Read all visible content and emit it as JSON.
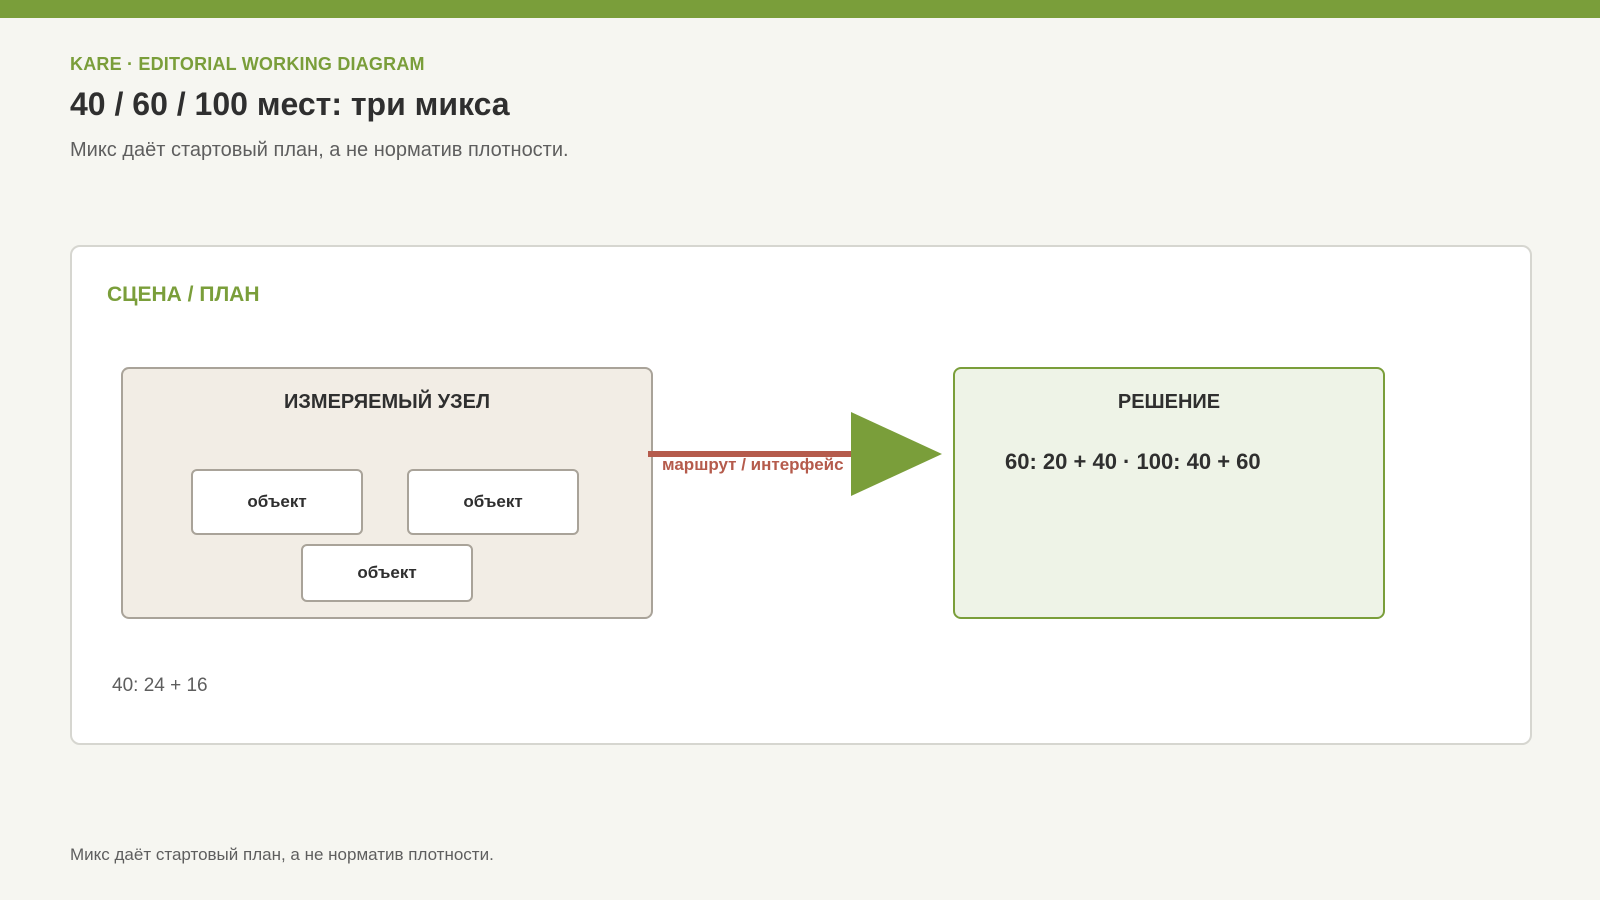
{
  "header": {
    "kicker": "KARE · EDITORIAL WORKING DIAGRAM",
    "title": "40 / 60 / 100 мест: три микса",
    "subtitle": "Микс даёт стартовый план, а не норматив плотности."
  },
  "panel": {
    "label": "СЦЕНА / ПЛАН",
    "node": {
      "title": "ИЗМЕРЯЕМЫЙ УЗЕЛ",
      "objects": [
        "объект",
        "объект",
        "объект"
      ]
    },
    "connector": {
      "label": "маршрут / интерфейс",
      "line_color": "#b55b4c",
      "arrow_color": "#7a9e3a"
    },
    "decision": {
      "title": "РЕШЕНИЕ",
      "value": "60: 20 + 40 · 100: 40 + 60"
    },
    "note": "40: 24 + 16"
  },
  "footer": {
    "note": "Микс даёт стартовый план, а не норматив плотности."
  },
  "colors": {
    "accent": "#7a9e3a",
    "connector": "#b55b4c",
    "background": "#f6f6f1"
  }
}
